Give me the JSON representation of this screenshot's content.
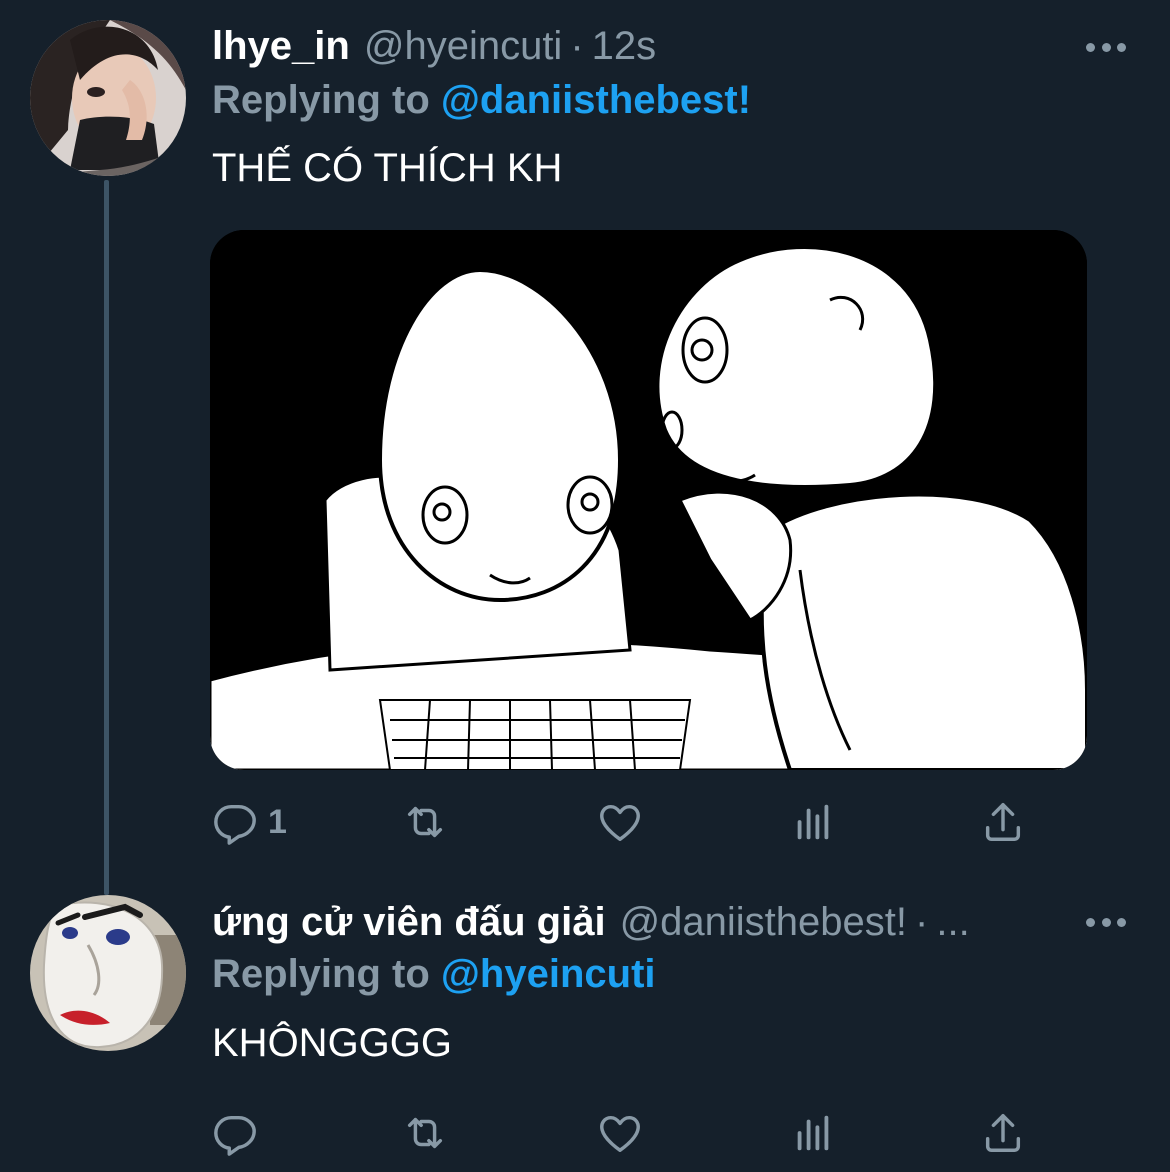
{
  "tweets": [
    {
      "display_name": "lhye_in",
      "handle": "@hyeincuti",
      "separator": "·",
      "time": "12s",
      "replying_prefix": "Replying to",
      "replying_handle": "@daniisthebest!",
      "text": "THẾ CÓ THÍCH KH",
      "has_media": true,
      "reply_count": "1",
      "avatar_icon": "profile-photo",
      "media_description": "black-and-white sketch"
    },
    {
      "display_name": "ứng cử viên đấu giải",
      "handle": "@daniisthebest!",
      "separator": "·",
      "time": "...",
      "replying_prefix": "Replying to",
      "replying_handle": "@hyeincuti",
      "text": "KHÔNGGGG",
      "has_media": false,
      "reply_count": "",
      "avatar_icon": "profile-photo"
    }
  ],
  "icons": [
    "reply-icon",
    "retweet-icon",
    "like-icon",
    "views-icon",
    "share-icon",
    "more-icon"
  ],
  "colors": {
    "background": "#15202b",
    "secondary_text": "#8899a6",
    "link": "#1da1f2",
    "thread_line": "#3d5466"
  }
}
